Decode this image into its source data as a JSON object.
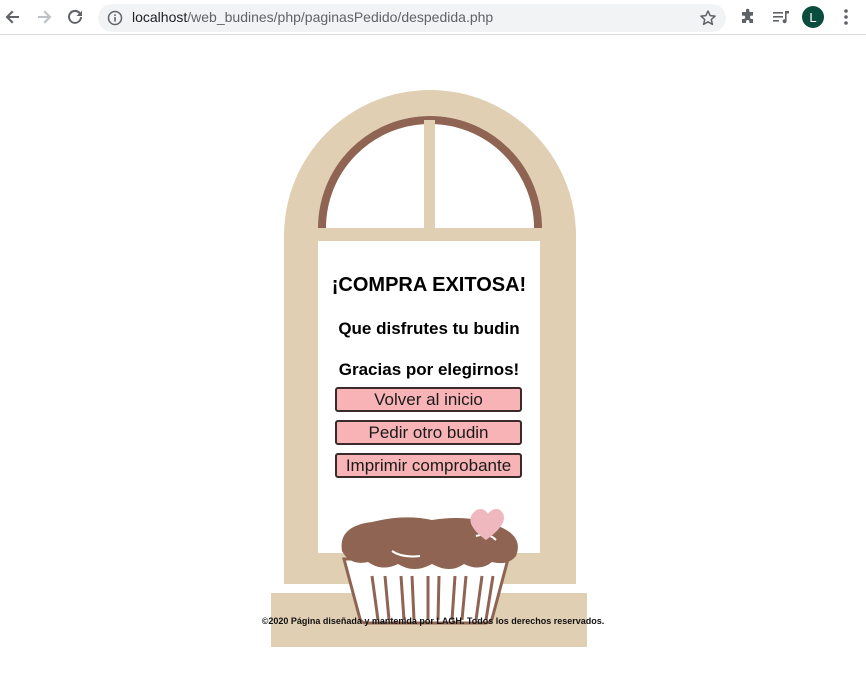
{
  "browser": {
    "url_host": "localhost",
    "url_path": "/web_budines/php/paginasPedido/despedida.php",
    "profile_initial": "L",
    "profile_color": "#0b4d3c"
  },
  "main": {
    "title": "¡COMPRA EXITOSA!",
    "subtitle": "Que disfrutes tu budin",
    "thanks": "Gracias por elegirnos!",
    "buttons": {
      "home": "Volver al inicio",
      "reorder": "Pedir otro budin",
      "print": "Imprimir comprobante"
    }
  },
  "footer": {
    "text": "©2020 Página diseñada y mantenida por LAGH. Todos los derechos reservados."
  },
  "colors": {
    "window_frame": "#e0cfb2",
    "window_arch": "#8f6452",
    "button_bg": "#f7b3b5",
    "cupcake": "#8f6452",
    "heart": "#efb8bf"
  }
}
